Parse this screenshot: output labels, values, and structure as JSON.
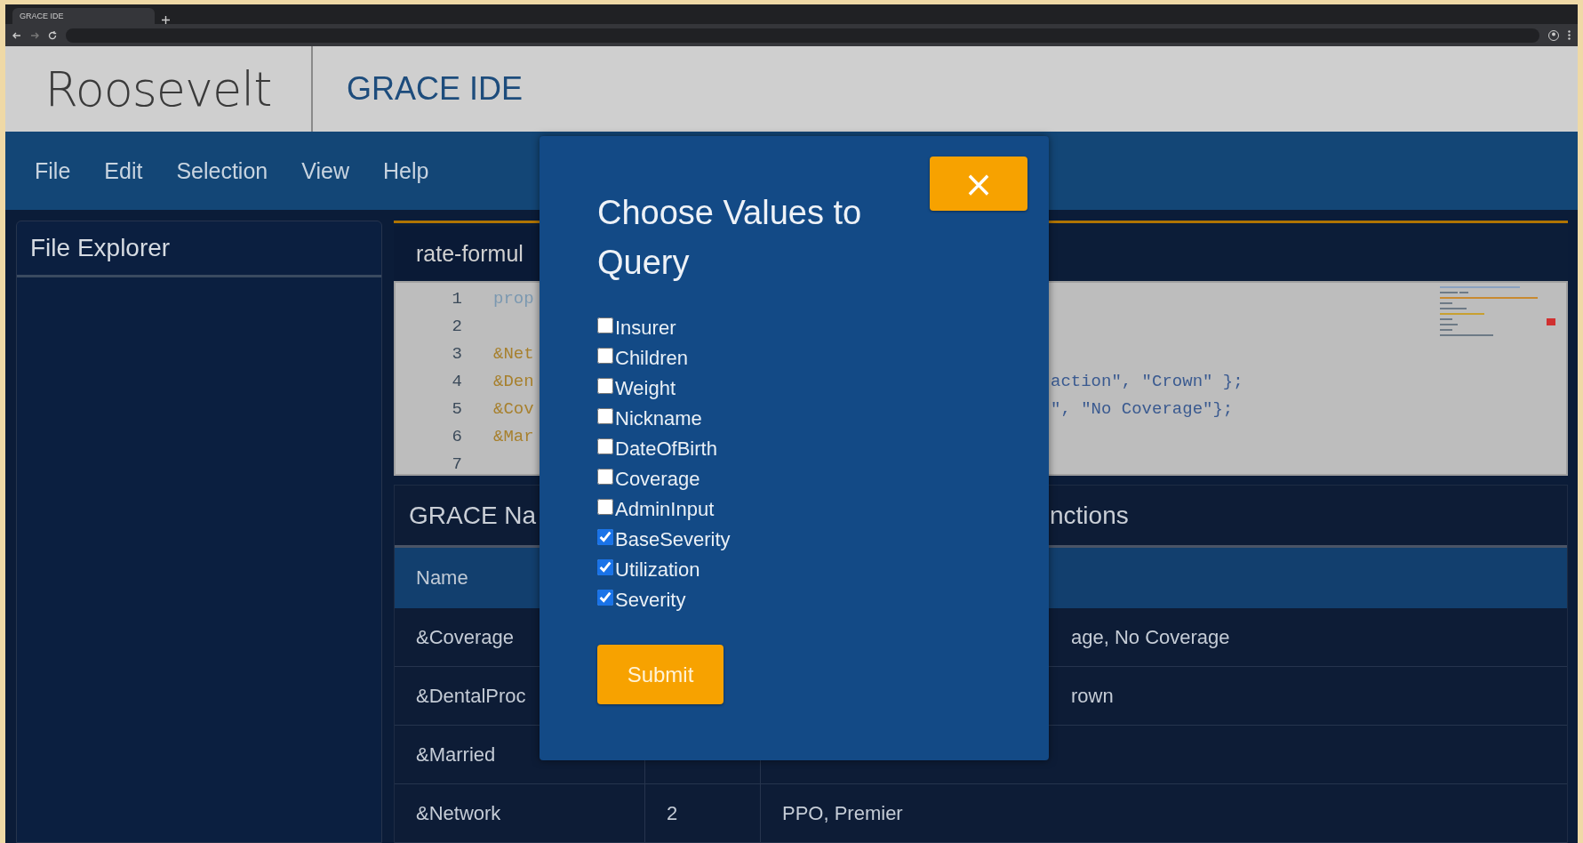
{
  "browser": {
    "tab_title": "GRACE IDE"
  },
  "header": {
    "logo": "Roosevelt",
    "title": "GRACE IDE"
  },
  "menu": [
    "File",
    "Edit",
    "Selection",
    "View",
    "Help"
  ],
  "explorer": {
    "title": "File Explorer"
  },
  "editor": {
    "tab": "rate-formul",
    "lines": [
      {
        "number": "1",
        "text": "prop",
        "kind": "keyword"
      },
      {
        "number": "2"
      },
      {
        "number": "3",
        "text": "&Net",
        "kind": "variable"
      },
      {
        "number": "4",
        "text": "&Den",
        "kind": "variable",
        "tail": "action\", \"Crown\" };"
      },
      {
        "number": "5",
        "text": "&Cov",
        "kind": "variable",
        "tail": "\", \"No Coverage\"};"
      },
      {
        "number": "6",
        "text": "&Mar",
        "kind": "variable"
      },
      {
        "number": "7"
      }
    ]
  },
  "names_panel": {
    "title": "GRACE Na",
    "title_tail": "nctions",
    "columns": [
      "Name"
    ],
    "rows": [
      {
        "name": "&Coverage",
        "values_tail": "age, No Coverage"
      },
      {
        "name": "&DentalProc",
        "values_tail": "rown"
      },
      {
        "name": "&Married"
      },
      {
        "name": "&Network",
        "count": "2",
        "values": "PPO, Premier"
      }
    ]
  },
  "dialog": {
    "close": "×",
    "title": "Choose Values to Query",
    "options": [
      {
        "label": "Insurer",
        "checked": false
      },
      {
        "label": "Children",
        "checked": false
      },
      {
        "label": "Weight",
        "checked": false
      },
      {
        "label": "Nickname",
        "checked": false
      },
      {
        "label": "DateOfBirth",
        "checked": false
      },
      {
        "label": "Coverage",
        "checked": false
      },
      {
        "label": "AdminInput",
        "checked": false
      },
      {
        "label": "BaseSeverity",
        "checked": true
      },
      {
        "label": "Utilization",
        "checked": true
      },
      {
        "label": "Severity",
        "checked": true
      }
    ],
    "submit": "Submit"
  }
}
